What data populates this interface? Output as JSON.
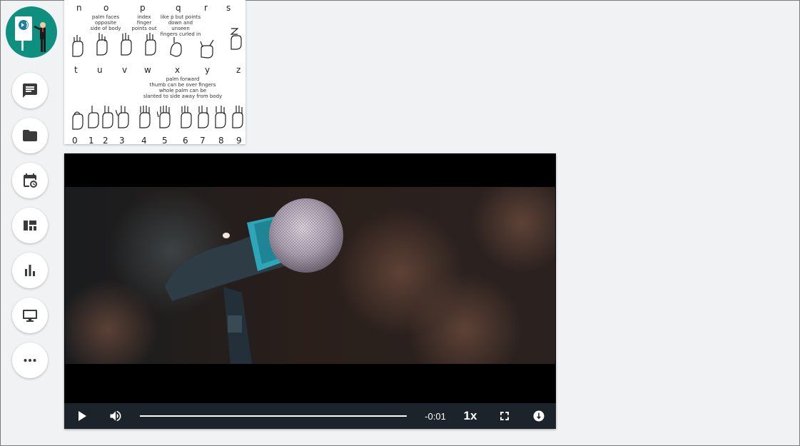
{
  "sidebar": {
    "items": [
      {
        "name": "chat",
        "icon": "chat-icon"
      },
      {
        "name": "files",
        "icon": "folder-icon"
      },
      {
        "name": "schedule",
        "icon": "calendar-clock-icon"
      },
      {
        "name": "dashboard",
        "icon": "dashboard-icon"
      },
      {
        "name": "stats",
        "icon": "bar-chart-icon"
      },
      {
        "name": "screen",
        "icon": "monitor-icon"
      },
      {
        "name": "more",
        "icon": "more-icon"
      }
    ]
  },
  "asl_chart": {
    "row1_letters": [
      "n",
      "o",
      "p",
      "q",
      "r",
      "s"
    ],
    "row1_notes": [
      "palm faces opposite\nside of body",
      "index finger\npoints out",
      "like p but points\ndown and unseen\nfingers curled in"
    ],
    "row2_letters": [
      "t",
      "u",
      "v",
      "w",
      "x",
      "y",
      "z"
    ],
    "row2_note": "palm forward\nthumb can be over fingers\nwhole palm can be\nslanted to side away from body",
    "digits": [
      "0",
      "1",
      "2",
      "3",
      "4",
      "5",
      "6",
      "7",
      "8",
      "9"
    ]
  },
  "player": {
    "time_remaining": "-0:01",
    "playback_rate": "1x",
    "progress": 0.99,
    "colors": {
      "controls_bg": "#1d232b",
      "progress": "#ffffff"
    }
  }
}
